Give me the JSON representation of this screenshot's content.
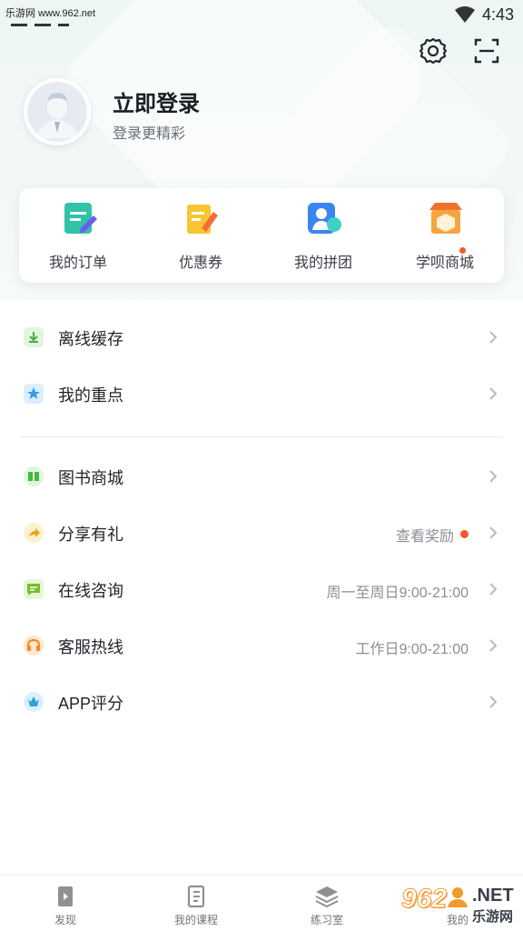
{
  "status_bar": {
    "watermark": "乐游网 www.962.net",
    "time": "4:43"
  },
  "header": {
    "settings_icon": "gear-icon",
    "scan_icon": "scan-icon",
    "login_title": "立即登录",
    "login_subtitle": "登录更精彩"
  },
  "quick_actions": [
    {
      "label": "我的订单",
      "icon": "order-icon",
      "badge": false
    },
    {
      "label": "优惠券",
      "icon": "coupon-icon",
      "badge": false
    },
    {
      "label": "我的拼团",
      "icon": "group-buy-icon",
      "badge": true
    },
    {
      "label": "学呗商城",
      "icon": "shop-icon",
      "badge": true
    }
  ],
  "menu_top": [
    {
      "label": "离线缓存",
      "icon": "download-icon",
      "color": "#5bbf5a"
    },
    {
      "label": "我的重点",
      "icon": "star-icon",
      "color": "#3aa3e3"
    }
  ],
  "menu_bottom": [
    {
      "label": "图书商城",
      "value": "",
      "icon": "book-icon",
      "color": "#4fc04f"
    },
    {
      "label": "分享有礼",
      "value": "查看奖励",
      "icon": "share-icon",
      "color": "#f0b020",
      "dot": true
    },
    {
      "label": "在线咨询",
      "value": "周一至周日9:00-21:00",
      "icon": "chat-icon",
      "color": "#7ccd3a"
    },
    {
      "label": "客服热线",
      "value": "工作日9:00-21:00",
      "icon": "headset-icon",
      "color": "#f49a2e"
    },
    {
      "label": "APP评分",
      "value": "",
      "icon": "rating-icon",
      "color": "#3aa7d8"
    }
  ],
  "bottom_nav": [
    {
      "label": "发现",
      "icon": "discover-icon"
    },
    {
      "label": "我的课程",
      "icon": "course-icon"
    },
    {
      "label": "练习室",
      "icon": "practice-icon"
    },
    {
      "label": "我的",
      "icon": "profile-icon"
    }
  ],
  "watermark_logo": {
    "number": "962",
    "suffix": ".NET",
    "text": "乐游网"
  }
}
